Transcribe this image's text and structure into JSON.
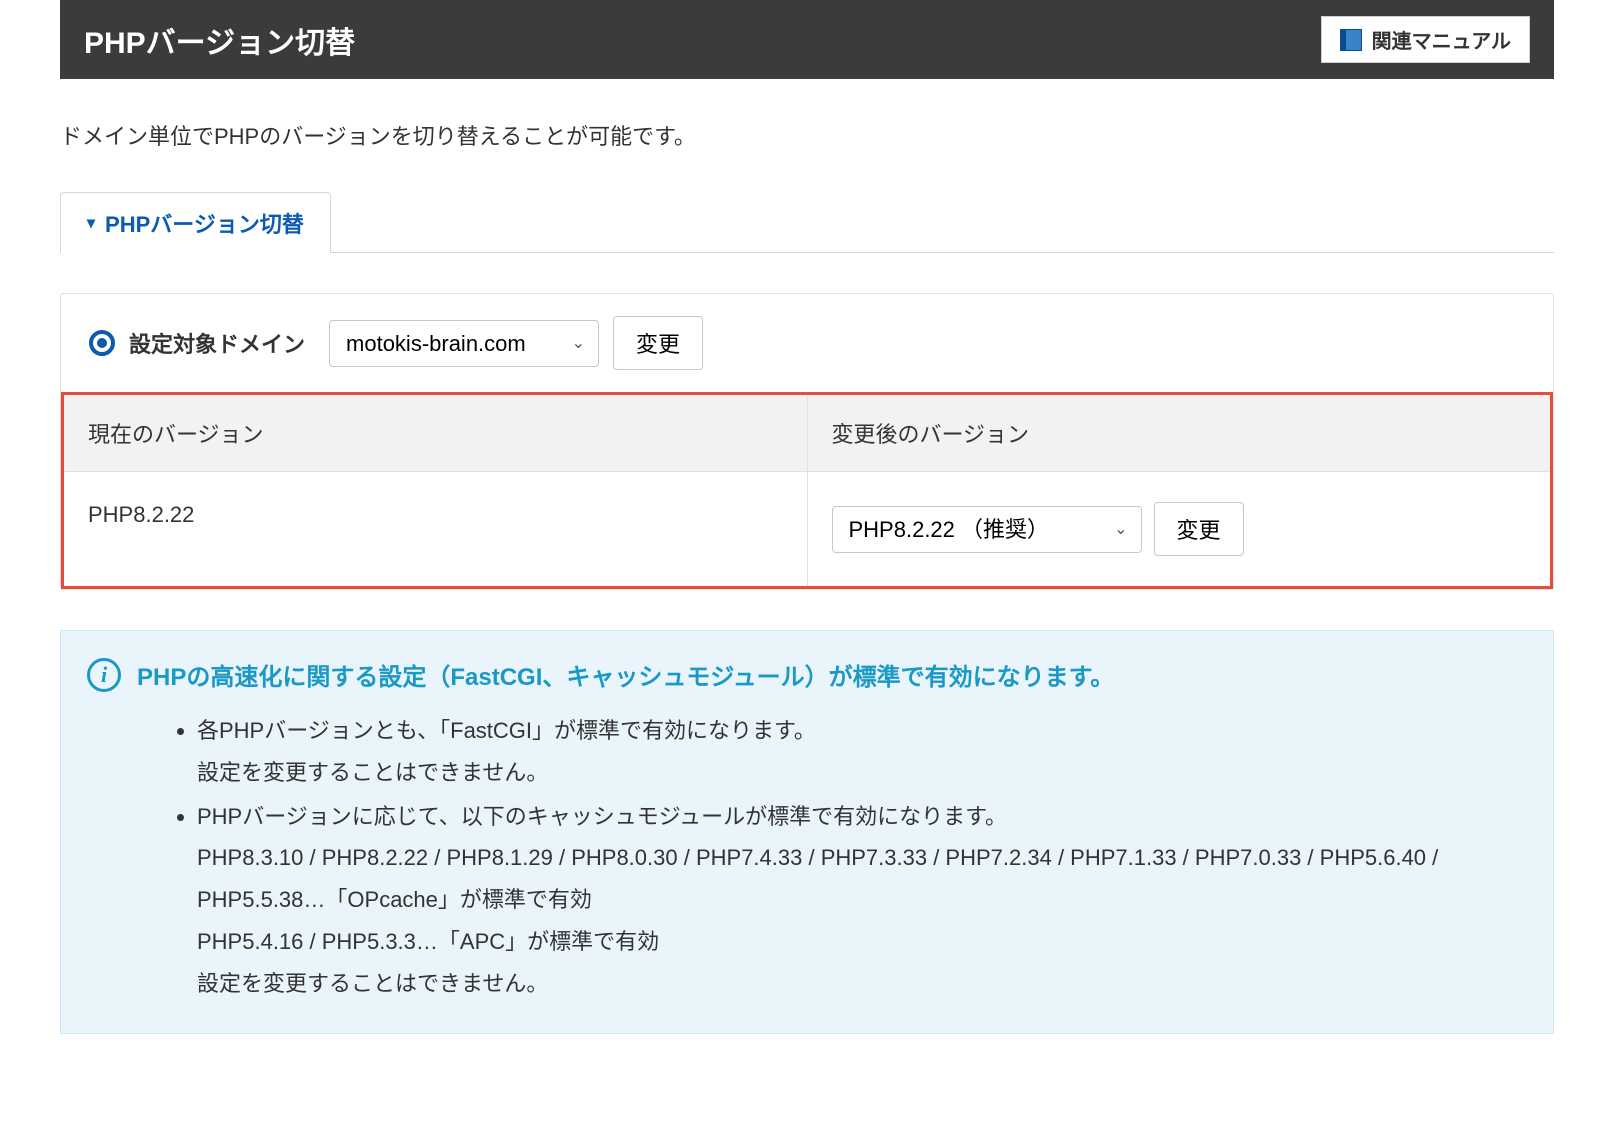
{
  "header": {
    "title": "PHPバージョン切替",
    "manual_button": "関連マニュアル"
  },
  "description": "ドメイン単位でPHPのバージョンを切り替えることが可能です。",
  "tab": {
    "label": "PHPバージョン切替"
  },
  "domain_section": {
    "label": "設定対象ドメイン",
    "selected": "motokis-brain.com",
    "change_button": "変更"
  },
  "version_table": {
    "header_current": "現在のバージョン",
    "header_new": "変更後のバージョン",
    "current_version": "PHP8.2.22",
    "new_version_selected": "PHP8.2.22 （推奨）",
    "change_button": "変更"
  },
  "info": {
    "title": "PHPの高速化に関する設定（FastCGI、キャッシュモジュール）が標準で有効になります。",
    "item1_line1": "各PHPバージョンとも、「FastCGI」が標準で有効になります。",
    "item1_line2": "設定を変更することはできません。",
    "item2_line1": "PHPバージョンに応じて、以下のキャッシュモジュールが標準で有効になります。",
    "item2_line2": "PHP8.3.10 / PHP8.2.22 / PHP8.1.29 / PHP8.0.30 / PHP7.4.33 / PHP7.3.33 / PHP7.2.34 / PHP7.1.33 / PHP7.0.33 / PHP5.6.40 / PHP5.5.38…「OPcache」が標準で有効",
    "item2_line3": "PHP5.4.16 / PHP5.3.3…「APC」が標準で有効",
    "item2_line4": "設定を変更することはできません。"
  }
}
